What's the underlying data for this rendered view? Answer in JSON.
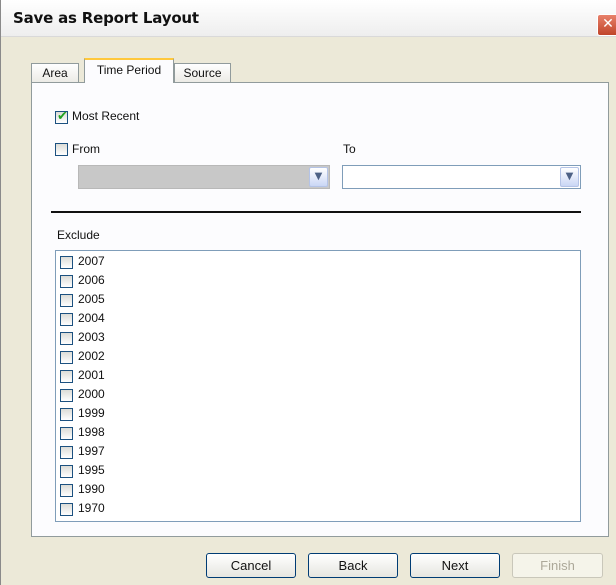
{
  "window": {
    "title": "Save as Report Layout",
    "close_glyph": "✕"
  },
  "tabs": [
    {
      "label": "Area"
    },
    {
      "label": "Time Period"
    },
    {
      "label": "Source"
    }
  ],
  "time_period": {
    "most_recent_label": "Most Recent",
    "most_recent_checked": true,
    "from_label": "From",
    "from_checked": false,
    "from_value": "",
    "to_label": "To",
    "to_value": "",
    "exclude_label": "Exclude",
    "exclude_years": [
      "2007",
      "2006",
      "2005",
      "2004",
      "2003",
      "2002",
      "2001",
      "2000",
      "1999",
      "1998",
      "1997",
      "1995",
      "1990",
      "1970"
    ]
  },
  "buttons": {
    "cancel": "Cancel",
    "back": "Back",
    "next": "Next",
    "finish": "Finish"
  },
  "colors": {
    "tab_highlight": "#ffc83c",
    "checkmark": "#21a121"
  }
}
